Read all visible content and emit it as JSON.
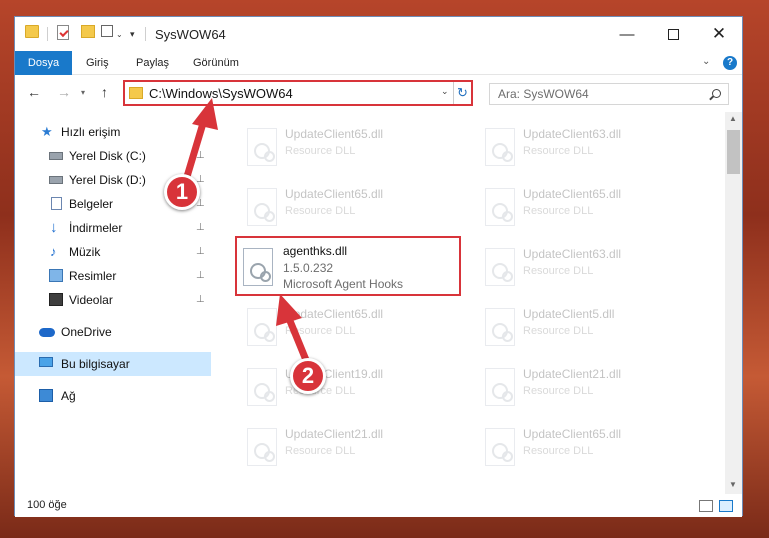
{
  "window": {
    "title": "SysWOW64",
    "min_icon": "—",
    "close_icon": "✕"
  },
  "ribbon": {
    "tabs": [
      "Dosya",
      "Giriş",
      "Paylaş",
      "Görünüm"
    ],
    "collapse_icon": "⌄",
    "help_label": "?"
  },
  "nav": {
    "back_icon": "←",
    "forward_icon": "→",
    "recent_icon": "▾",
    "up_icon": "↑",
    "address_path": "C:\\Windows\\SysWOW64",
    "dropdown_icon": "⌄",
    "refresh_icon": "↻",
    "search_placeholder": "Ara: SysWOW64"
  },
  "sidebar": {
    "items": [
      {
        "label": "Hızlı erişim",
        "icon": "star-icon",
        "pinned": false
      },
      {
        "label": "Yerel Disk (C:)",
        "icon": "drive-icon",
        "pinned": true
      },
      {
        "label": "Yerel Disk (D:)",
        "icon": "drive-icon",
        "pinned": true
      },
      {
        "label": "Belgeler",
        "icon": "documents-icon",
        "pinned": true
      },
      {
        "label": "İndirmeler",
        "icon": "downloads-icon",
        "pinned": true
      },
      {
        "label": "Müzik",
        "icon": "music-icon",
        "pinned": true
      },
      {
        "label": "Resimler",
        "icon": "pictures-icon",
        "pinned": true
      },
      {
        "label": "Videolar",
        "icon": "videos-icon",
        "pinned": true
      },
      {
        "label": "OneDrive",
        "icon": "onedrive-icon",
        "pinned": false
      },
      {
        "label": "Bu bilgisayar",
        "icon": "this-pc-icon",
        "pinned": false,
        "selected": true
      },
      {
        "label": "Ağ",
        "icon": "network-icon",
        "pinned": false
      }
    ],
    "pin_glyph": "📌"
  },
  "files": [
    {
      "name": "UpdateClient65.dll",
      "sub": "Resource DLL",
      "faded": true
    },
    {
      "name": "UpdateClient63.dll",
      "sub": "Resource DLL",
      "faded": true
    },
    {
      "name": "UpdateClient65.dll",
      "sub": "Resource DLL",
      "faded": true
    },
    {
      "name": "UpdateClient65.dll",
      "sub": "Resource DLL",
      "faded": true
    },
    {
      "name": "agenthks.dll",
      "version": "1.5.0.232",
      "description": "Microsoft Agent Hooks",
      "faded": false,
      "highlighted": true
    },
    {
      "name": "UpdateClient63.dll",
      "sub": "Resource DLL",
      "faded": true
    },
    {
      "name": "UpdateClient65.dll",
      "sub": "Resource DLL",
      "faded": true
    },
    {
      "name": "UpdateClient5.dll",
      "sub": "Resource DLL",
      "faded": true
    },
    {
      "name": "UpdateClient19.dll",
      "sub": "Resource DLL",
      "faded": true
    },
    {
      "name": "UpdateClient21.dll",
      "sub": "Resource DLL",
      "faded": true
    },
    {
      "name": "UpdateClient21.dll",
      "sub": "Resource DLL",
      "faded": true
    },
    {
      "name": "UpdateClient65.dll",
      "sub": "Resource DLL",
      "faded": true
    }
  ],
  "status": {
    "item_count": "100 öğe"
  },
  "annotations": {
    "step1": "1",
    "step2": "2",
    "accent_color": "#d8343a"
  },
  "colors": {
    "file_tab": "#1979ca",
    "selected_bg": "#cce8ff",
    "highlight_border": "#d8343a"
  }
}
